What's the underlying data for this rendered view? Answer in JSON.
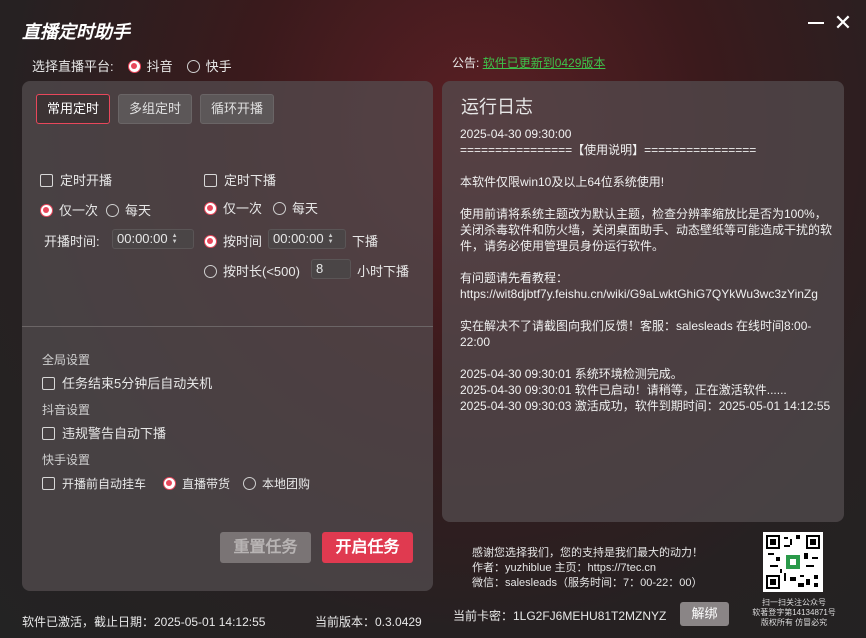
{
  "app": {
    "title": "直播定时助手"
  },
  "platform": {
    "label": "选择直播平台:",
    "options": [
      {
        "label": "抖音",
        "selected": true
      },
      {
        "label": "快手",
        "selected": false
      }
    ]
  },
  "notice": {
    "label": "公告:",
    "link": "软件已更新到0429版本"
  },
  "tabs": [
    {
      "label": "常用定时",
      "active": true
    },
    {
      "label": "多组定时",
      "active": false
    },
    {
      "label": "循环开播",
      "active": false
    }
  ],
  "start": {
    "checkbox": "定时开播",
    "mode_once": "仅一次",
    "mode_daily": "每天",
    "time_label": "开播时间:",
    "time_value": "00:00:00"
  },
  "stop": {
    "checkbox": "定时下播",
    "mode_once": "仅一次",
    "mode_daily": "每天",
    "by_time_label": "按时间",
    "by_time_value": "00:00:00",
    "by_time_suffix": "下播",
    "by_duration_label": "按时长(<500)",
    "by_duration_value": "8",
    "by_duration_suffix": "小时下播"
  },
  "global": {
    "title": "全局设置",
    "shutdown": "任务结束5分钟后自动关机"
  },
  "douyin": {
    "title": "抖音设置",
    "violation": "违规警告自动下播"
  },
  "kuaishou": {
    "title": "快手设置",
    "auto_hang": "开播前自动挂车",
    "options": [
      {
        "label": "直播带货",
        "selected": true
      },
      {
        "label": "本地团购",
        "selected": false
      }
    ]
  },
  "buttons": {
    "reset": "重置任务",
    "start": "开启任务",
    "unbind": "解绑"
  },
  "log": {
    "title": "运行日志",
    "text": "2025-04-30 09:30:00\n================【使用说明】================\n\n本软件仅限win10及以上64位系统使用!\n\n使用前请将系统主题改为默认主题，检查分辨率缩放比是否为100%，关闭杀毒软件和防火墙，关闭桌面助手、动态壁纸等可能造成干扰的软件，请务必使用管理员身份运行软件。\n\n有问题请先看教程：https://wit8djbtf7y.feishu.cn/wiki/G9aLwktGhiG7QYkWu3wc3zYinZg\n\n实在解决不了请截图向我们反馈！客服：salesleads 在线时间8:00-22:00\n\n2025-04-30 09:30:01 系统环境检测完成。\n2025-04-30 09:30:01 软件已启动！请稍等，正在激活软件......\n2025-04-30 09:30:03 激活成功，软件到期时间：2025-05-01 14:12:55"
  },
  "footer": {
    "thanks": "感谢您选择我们，您的支持是我们最大的动力！",
    "author": "作者：yuzhiblue 主页：https://7tec.cn",
    "wechat": "微信：salesleads（服务时间：7：00-22：00）",
    "qr_caption": "扫一扫关注公众号\n软著登字第14134871号\n版权所有 仿冒必究"
  },
  "status": {
    "activation": "软件已激活，截止日期：2025-05-01 14:12:55",
    "version": "当前版本：0.3.0429",
    "card": "当前卡密：1LG2FJ6MEHU81T2MZNYZ"
  },
  "colors": {
    "accent": "#e03a50",
    "link": "#3ec24a"
  }
}
